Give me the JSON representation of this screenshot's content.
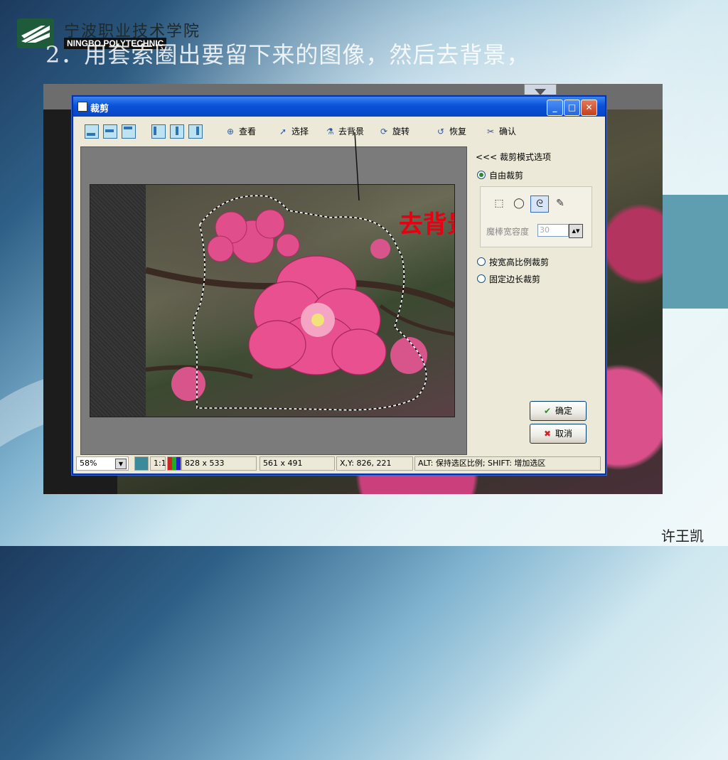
{
  "slide": {
    "title": "2．用套索圈出要留下来的图像，然后去背景，",
    "author": "许王凯"
  },
  "logo": {
    "cn_name": "宁波职业技术学院",
    "en_name": "NINGBO POLYTECHNIC"
  },
  "window": {
    "title": "裁剪",
    "controls": {
      "minimize": "_",
      "maximize": "□",
      "close": "✕"
    }
  },
  "toolbar": {
    "layout_buttons": [
      "layout-1",
      "layout-2",
      "layout-3",
      "layout-4",
      "layout-5",
      "layout-6"
    ],
    "view": "查看",
    "select": "选择",
    "remove_bg": "去背景",
    "rotate": "旋转",
    "restore": "恢复",
    "confirm": "确认"
  },
  "annotation": {
    "text": "去背景",
    "color": "#e60012"
  },
  "crop_panel": {
    "title": "<<< 裁剪模式选项",
    "free_crop": "自由裁剪",
    "selection_tools": [
      "rect-select",
      "ellipse-select",
      "lasso-select",
      "magic-wand"
    ],
    "active_tool": "lasso-select",
    "tolerance_label": "魔棒宽容度",
    "tolerance_value": "30",
    "aspect_crop": "按宽高比例裁剪",
    "fixed_crop": "固定边长裁剪",
    "ok": "确定",
    "cancel": "取消"
  },
  "statusbar": {
    "zoom": "58%",
    "ratio_button": "1:1",
    "image_size": "828 x 533",
    "selection_size": "561 x 491",
    "coords": "X,Y: 826, 221",
    "hint": "ALT: 保持选区比例;  SHIFT: 增加选区"
  },
  "colors": {
    "xp_title_blue": "#0a52d8",
    "window_face": "#ece9d8",
    "ok_check": "#2a8a2a",
    "cancel_x": "#d62020"
  }
}
